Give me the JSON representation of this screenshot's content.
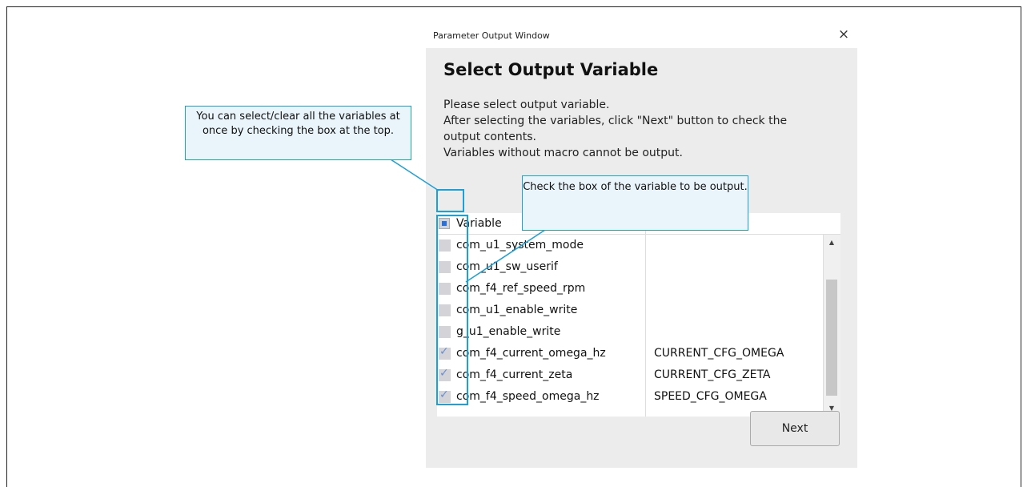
{
  "window": {
    "title": "Parameter Output Window",
    "close_icon": "×"
  },
  "heading": "Select Output Variable",
  "description": [
    "Please select output variable.",
    "After selecting the variables, click \"Next\" button to check the",
    "output contents.",
    "Variables without macro cannot be output."
  ],
  "table": {
    "header_label": "Variable",
    "rows": [
      {
        "variable": "com_u1_system_mode",
        "macro": "",
        "checked": false
      },
      {
        "variable": "com_u1_sw_userif",
        "macro": "",
        "checked": false
      },
      {
        "variable": "com_f4_ref_speed_rpm",
        "macro": "",
        "checked": false
      },
      {
        "variable": "com_u1_enable_write",
        "macro": "",
        "checked": false
      },
      {
        "variable": "g_u1_enable_write",
        "macro": "",
        "checked": false
      },
      {
        "variable": "com_f4_current_omega_hz",
        "macro": "CURRENT_CFG_OMEGA",
        "checked": true
      },
      {
        "variable": "com_f4_current_zeta",
        "macro": "CURRENT_CFG_ZETA",
        "checked": true
      },
      {
        "variable": "com_f4_speed_omega_hz",
        "macro": "SPEED_CFG_OMEGA",
        "checked": true
      }
    ]
  },
  "next_button": "Next",
  "callouts": {
    "select_all": "You can select/clear all the variables at once by checking the box at the top.",
    "check_box": "Check the box of the variable to be output."
  },
  "colors": {
    "callout_border": "#1d9fd7",
    "callout_bg": "#e9f5fb",
    "checkbox_check": "#6a8fd0"
  }
}
